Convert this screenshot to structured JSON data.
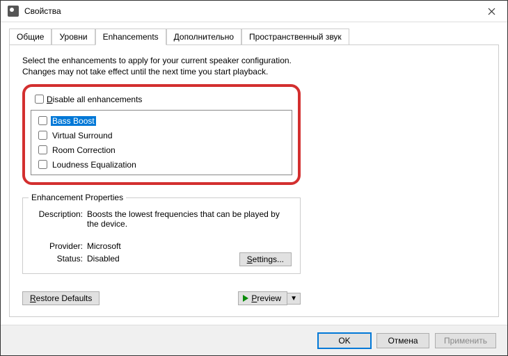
{
  "titlebar": {
    "title": "Свойства"
  },
  "tabs": {
    "general": "Общие",
    "levels": "Уровни",
    "enhancements": "Enhancements",
    "advanced": "Дополнительно",
    "spatial": "Пространственный звук"
  },
  "description": "Select the enhancements to apply for your current speaker configuration. Changes may not take effect until the next time you start playback.",
  "disable_all_prefix": "D",
  "disable_all_rest": "isable all enhancements",
  "enhancements": [
    {
      "label": "Bass Boost",
      "selected": true
    },
    {
      "label": "Virtual Surround",
      "selected": false
    },
    {
      "label": "Room Correction",
      "selected": false
    },
    {
      "label": "Loudness Equalization",
      "selected": false
    }
  ],
  "properties": {
    "legend": "Enhancement Properties",
    "description_label": "Description:",
    "description_value": "Boosts the lowest frequencies that can be played by the device.",
    "provider_label": "Provider:",
    "provider_value": "Microsoft",
    "status_label": "Status:",
    "status_value": "Disabled",
    "settings_prefix": "S",
    "settings_rest": "ettings..."
  },
  "actions": {
    "restore_prefix": "R",
    "restore_rest": "estore Defaults",
    "preview_prefix": "P",
    "preview_rest": "review"
  },
  "footer": {
    "ok": "OK",
    "cancel": "Отмена",
    "apply": "Применить"
  }
}
